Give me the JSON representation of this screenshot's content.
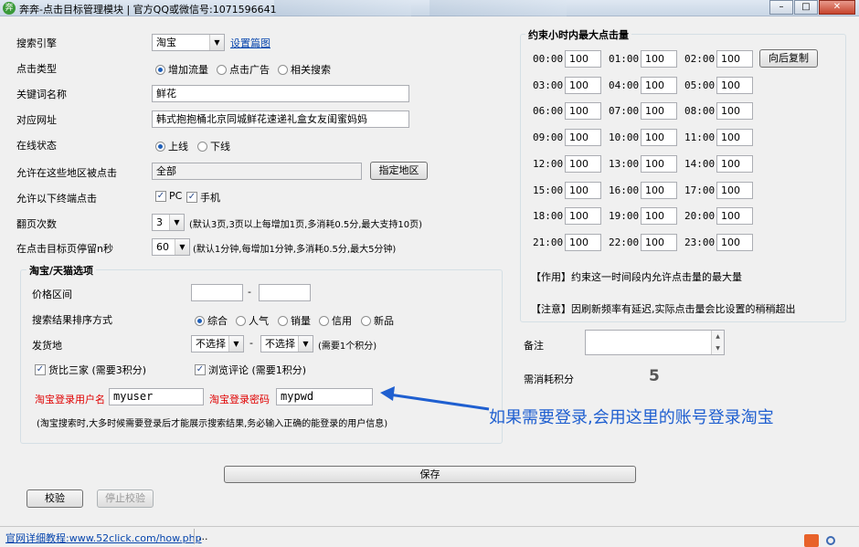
{
  "window": {
    "title": "奔奔-点击目标管理模块 | 官方QQ或微信号:1071596641"
  },
  "form": {
    "engine": {
      "label": "搜索引擎",
      "value": "淘宝",
      "link": "设置篇图"
    },
    "click_type": {
      "label": "点击类型",
      "options": [
        "增加流量",
        "点击广告",
        "相关搜索"
      ],
      "selected": 0
    },
    "keyword": {
      "label": "关键词名称",
      "value": "鲜花"
    },
    "url": {
      "label": "对应网址",
      "value": "韩式抱抱桶北京同城鲜花速递礼盒女友闺蜜妈妈"
    },
    "online": {
      "label": "在线状态",
      "options": [
        "上线",
        "下线"
      ],
      "selected": 0
    },
    "region": {
      "label": "允许在这些地区被点击",
      "value": "全部",
      "button": "指定地区"
    },
    "terminal": {
      "label": "允许以下终端点击",
      "options": [
        "PC",
        "手机"
      ]
    },
    "pages": {
      "label": "翻页次数",
      "value": "3",
      "note": "(默认3页,3页以上每增加1页,多消耗0.5分,最大支持10页)"
    },
    "stay": {
      "label": "在点击目标页停留n秒",
      "value": "60",
      "note": "(默认1分钟,每增加1分钟,多消耗0.5分,最大5分钟)"
    }
  },
  "taobao": {
    "title": "淘宝/天猫选项",
    "price_label": "价格区间",
    "price_sep": "-",
    "sort_label": "搜索结果排序方式",
    "sort_options": [
      "综合",
      "人气",
      "销量",
      "信用",
      "新品"
    ],
    "sort_selected": 0,
    "ship_label": "发货地",
    "ship_value1": "不选择",
    "ship_value2": "不选择",
    "ship_sep": "-",
    "ship_note": "(需要1个积分)",
    "compare": "货比三家 (需要3积分)",
    "review": "浏览评论 (需要1积分)",
    "user_label": "淘宝登录用户名",
    "user_value": "myuser",
    "pwd_label": "淘宝登录密码",
    "pwd_value": "mypwd",
    "hint": "(淘宝搜索时,大多时候需要登录后才能展示搜索结果,务必输入正确的能登录的用户信息)"
  },
  "annotation": "如果需要登录,会用这里的账号登录淘宝",
  "hours": {
    "title": "约束小时内最大点击量",
    "copy_button": "向后复制",
    "slots": [
      {
        "time": "00:00",
        "value": "100"
      },
      {
        "time": "01:00",
        "value": "100"
      },
      {
        "time": "02:00",
        "value": "100"
      },
      {
        "time": "03:00",
        "value": "100"
      },
      {
        "time": "04:00",
        "value": "100"
      },
      {
        "time": "05:00",
        "value": "100"
      },
      {
        "time": "06:00",
        "value": "100"
      },
      {
        "time": "07:00",
        "value": "100"
      },
      {
        "time": "08:00",
        "value": "100"
      },
      {
        "time": "09:00",
        "value": "100"
      },
      {
        "time": "10:00",
        "value": "100"
      },
      {
        "time": "11:00",
        "value": "100"
      },
      {
        "time": "12:00",
        "value": "100"
      },
      {
        "time": "13:00",
        "value": "100"
      },
      {
        "time": "14:00",
        "value": "100"
      },
      {
        "time": "15:00",
        "value": "100"
      },
      {
        "time": "16:00",
        "value": "100"
      },
      {
        "time": "17:00",
        "value": "100"
      },
      {
        "time": "18:00",
        "value": "100"
      },
      {
        "time": "19:00",
        "value": "100"
      },
      {
        "time": "20:00",
        "value": "100"
      },
      {
        "time": "21:00",
        "value": "100"
      },
      {
        "time": "22:00",
        "value": "100"
      },
      {
        "time": "23:00",
        "value": "100"
      }
    ],
    "note1": "【作用】约束这一时间段内允许点击量的最大量",
    "note2": "【注意】因刷新频率有延迟,实际点击量会比设置的稍稍超出"
  },
  "remark": {
    "label": "备注",
    "value": ""
  },
  "cost": {
    "label": "需消耗积分",
    "value": "5"
  },
  "buttons": {
    "save": "保存",
    "verify": "校验",
    "stop_verify": "停止校验"
  },
  "status": {
    "tutorial": "官网详细教程:www.52click.com/how.php",
    "dots": "..."
  },
  "colors": {
    "annotation": "#1f5fd0",
    "required_label": "#e00000"
  }
}
